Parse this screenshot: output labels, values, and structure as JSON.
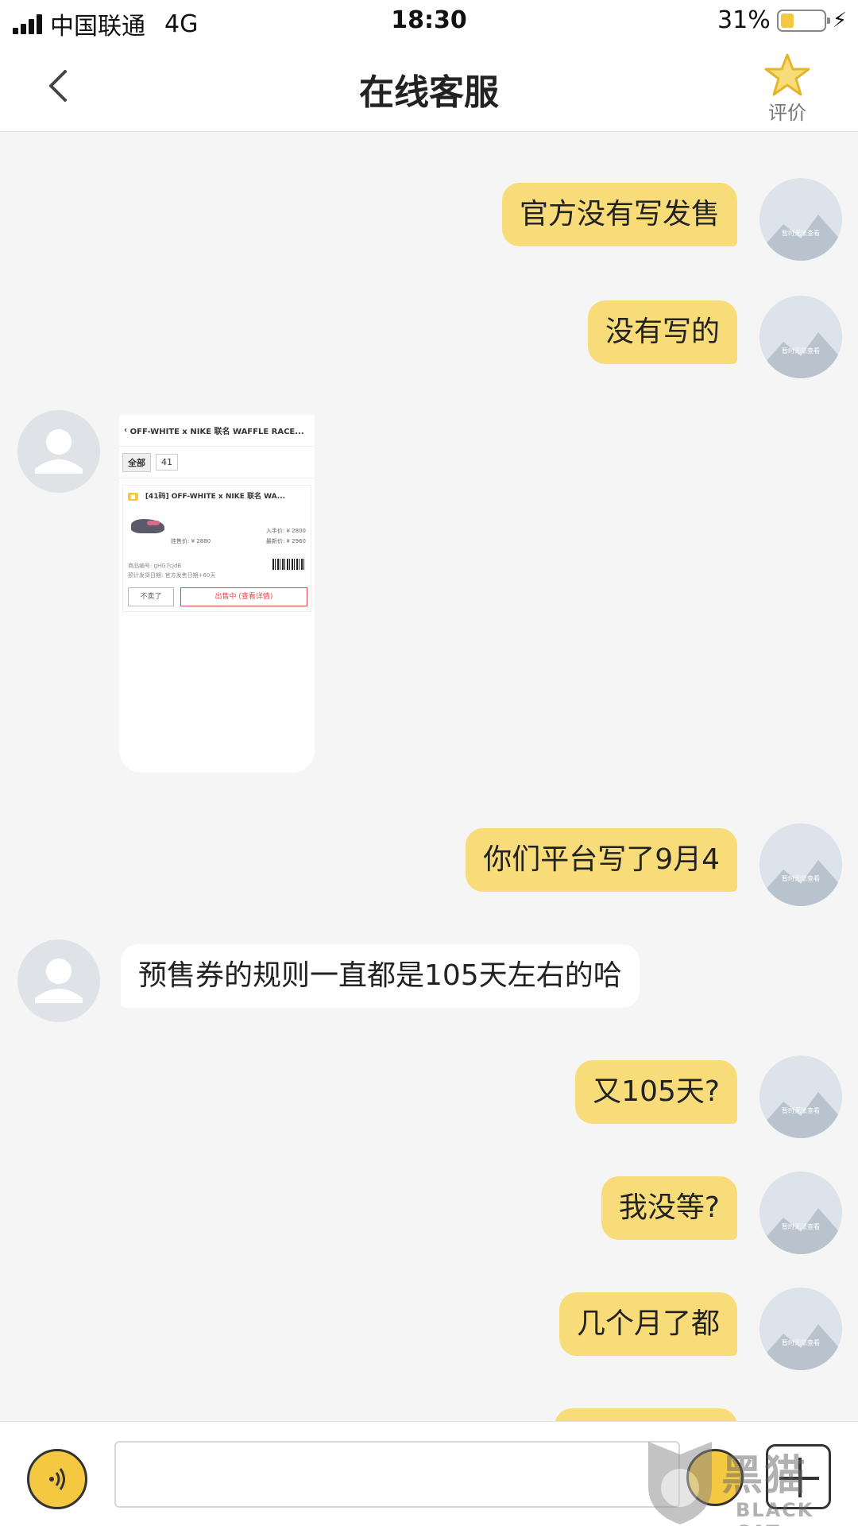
{
  "status_bar": {
    "carrier": "中国联通",
    "network": "4G",
    "time": "18:30",
    "battery": "31%",
    "battery_level": 0.31
  },
  "nav": {
    "title": "在线客服",
    "rate_label": "评价",
    "back_icon": "chevron-left-icon",
    "rate_icon": "star-icon"
  },
  "avatar_placeholder": "暂时无法查看",
  "messages": [
    {
      "from": "me",
      "text": "官方没有写发售"
    },
    {
      "from": "me",
      "text": "没有写的"
    },
    {
      "from": "them",
      "type": "image"
    },
    {
      "from": "me",
      "text": "你们平台写了9月4"
    },
    {
      "from": "them",
      "text": "预售券的规则一直都是105天左右的哈"
    },
    {
      "from": "me",
      "text": "又105天?"
    },
    {
      "from": "me",
      "text": "我没等?"
    },
    {
      "from": "me",
      "text": "几个月了都"
    }
  ],
  "screenshot_card": {
    "header": "OFF-WHITE x NIKE 联名 WAFFLE RACE...",
    "filter_all": "全部",
    "filter_size": "41",
    "item_title": "[41码] OFF-WHITE x NIKE 联名 WA...",
    "price_buy": "入手价: ¥ 2800",
    "price_latest": "最新价: ¥ 2960",
    "price_left": "挂售价: ¥ 2880",
    "item_code": "商品编号: gHG7cjdB",
    "ship_date": "预计发货日期: 官方发售日期+60天",
    "btn_not_sell": "不卖了",
    "btn_selling": "出售中 (查看详情)"
  },
  "input_bar": {
    "voice_icon": "voice-icon",
    "emoji_icon": "emoji-icon",
    "plus_icon": "plus-icon",
    "input_value": ""
  },
  "watermark": {
    "cn": "黑猫",
    "en": "BLACK CAT"
  },
  "colors": {
    "bubble_me": "#f8dc79",
    "bubble_them": "#ffffff",
    "accent": "#f5c842",
    "background": "#f5f5f5"
  }
}
